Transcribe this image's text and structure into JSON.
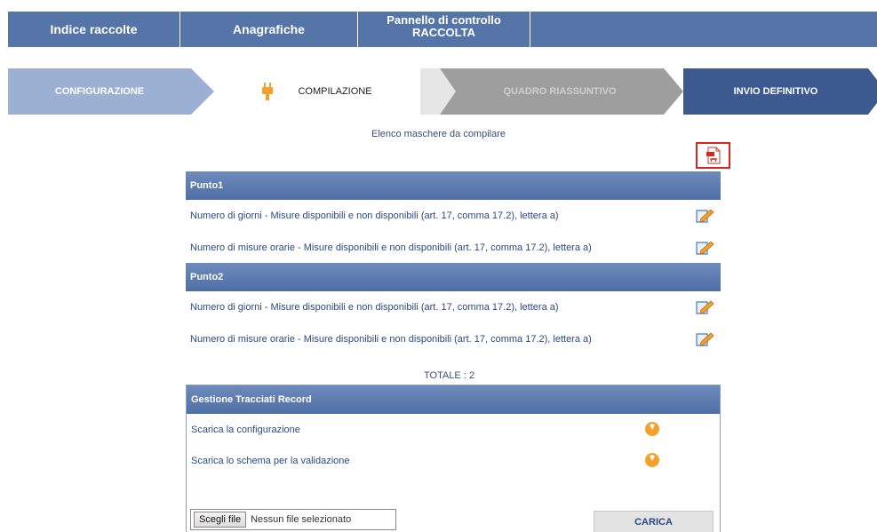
{
  "topnav": {
    "tab1": "Indice raccolte",
    "tab2": "Anagrafiche",
    "tab3_line1": "Pannello di controllo",
    "tab3_line2": "RACCOLTA"
  },
  "steps": {
    "s1": "CONFIGURAZIONE",
    "s2": "COMPILAZIONE",
    "s3": "QUADRO RIASSUNTIVO",
    "s4": "INVIO DEFINITIVO",
    "active": "COMPILAZIONE"
  },
  "subtitle": "Elenco maschere da compilare",
  "icons": {
    "pdf": "pdf-icon",
    "edit": "edit-pencil-icon",
    "download": "download-icon",
    "plug": "plug-icon"
  },
  "punti": [
    {
      "title": "Punto1",
      "rows": [
        "Numero di giorni - Misure disponibili e non disponibili (art. 17, comma 17.2), lettera a)",
        "Numero di misure orarie - Misure disponibili e non disponibili (art. 17, comma 17.2), lettera a)"
      ]
    },
    {
      "title": "Punto2",
      "rows": [
        "Numero di giorni - Misure disponibili e non disponibili (art. 17, comma 17.2), lettera a)",
        "Numero di misure orarie - Misure disponibili e non disponibili (art. 17, comma 17.2), lettera a)"
      ]
    }
  ],
  "totale": "TOTALE : 2",
  "gestione": {
    "title": "Gestione Tracciati Record",
    "rows": [
      "Scarica la configurazione",
      "Scarica lo schema per la validazione"
    ],
    "file_button": "Scegli file",
    "file_status": "Nessun file selezionato",
    "upload_button": "CARICA"
  },
  "colors": {
    "nav": "#5574a8",
    "step_active_dark": "#3c5a8f",
    "step_done": "#9cb0d4",
    "step_inactive": "#9e9e9e",
    "highlight_box": "#d9261c",
    "download": "#f2a22b"
  }
}
